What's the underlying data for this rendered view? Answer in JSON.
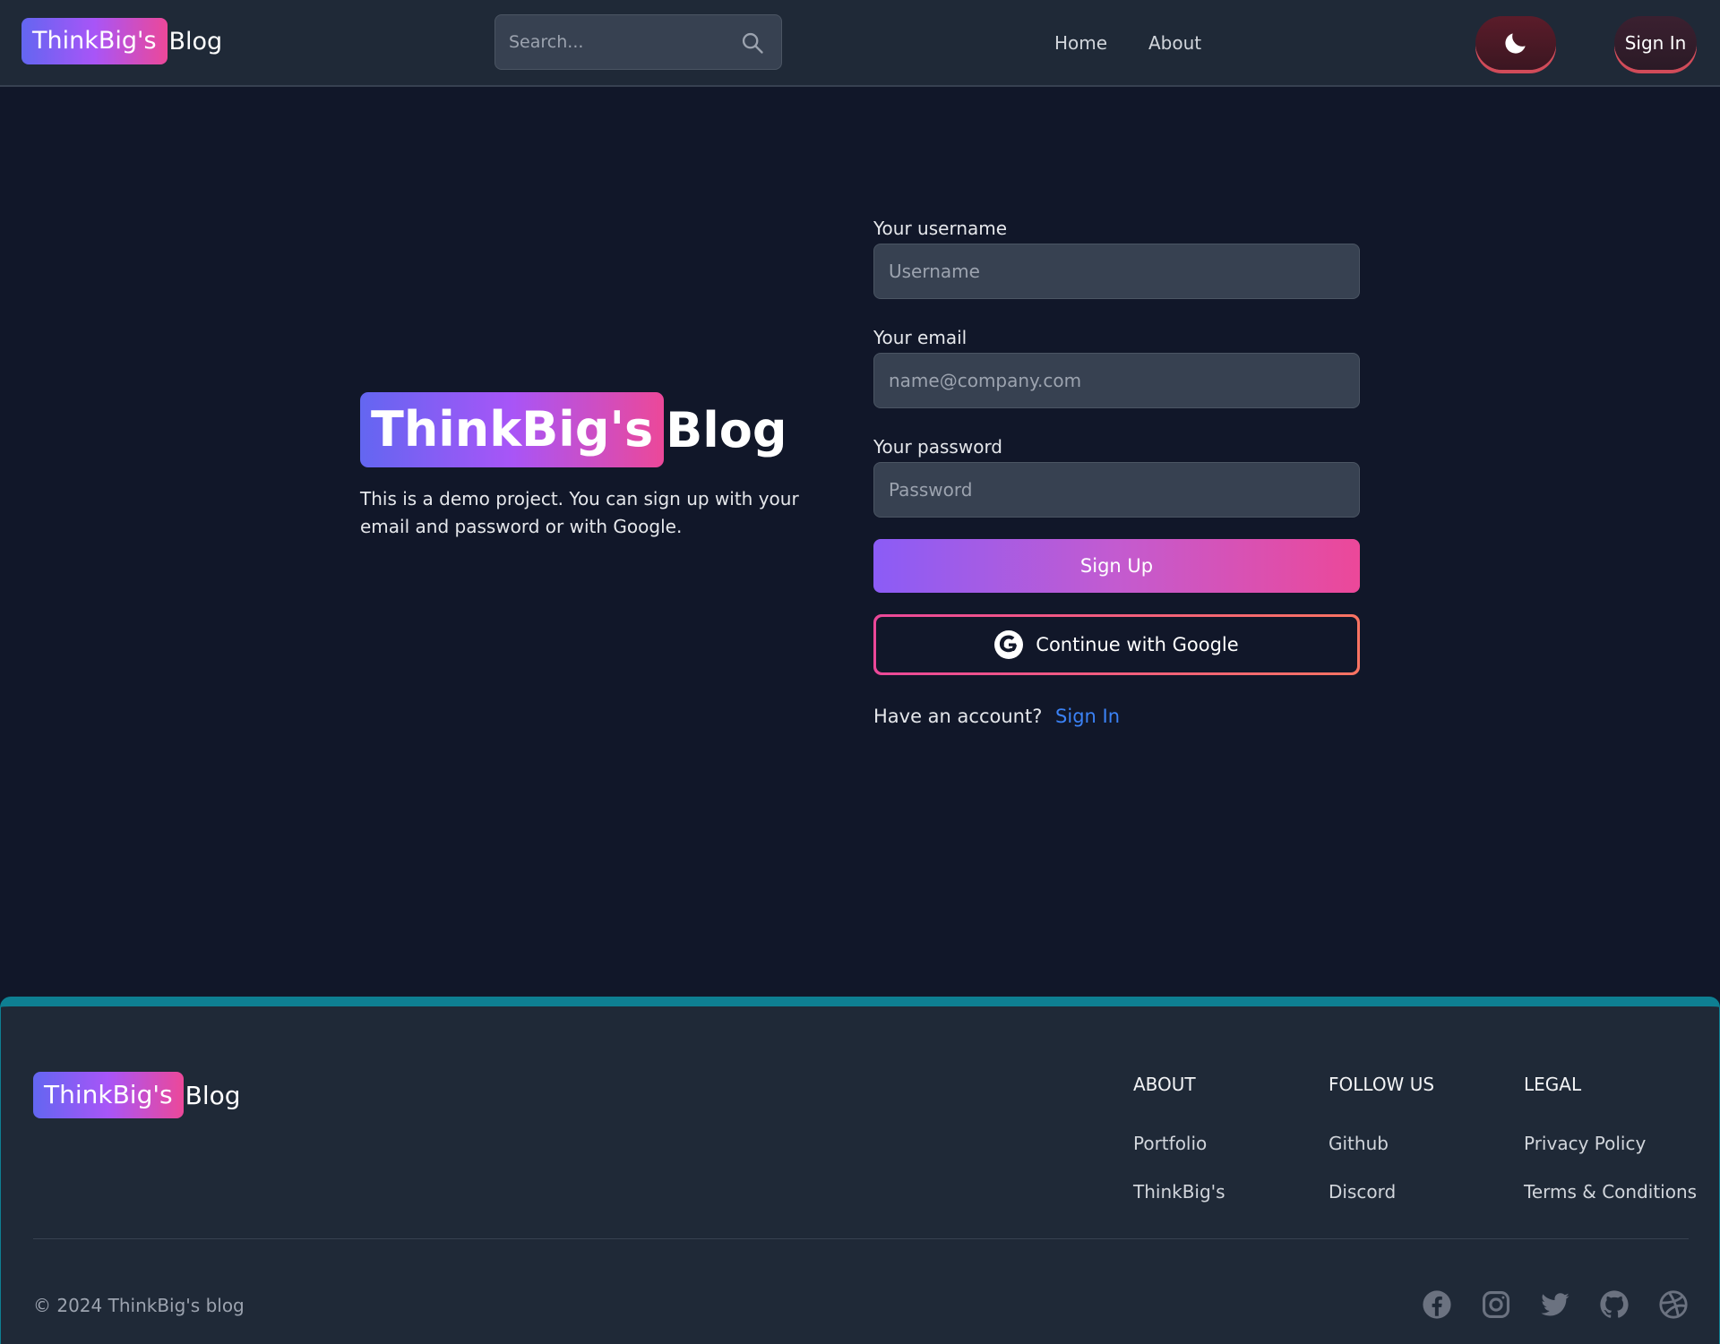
{
  "header": {
    "brand_badge": "ThinkBig's",
    "brand_rest": "Blog",
    "search_placeholder": "Search...",
    "nav": [
      {
        "label": "Home"
      },
      {
        "label": "About"
      }
    ],
    "theme_icon": "moon-icon",
    "signin_label": "Sign In"
  },
  "hero": {
    "brand_badge": "ThinkBig's",
    "brand_rest": "Blog",
    "description": "This is a demo project. You can sign up with your email and password or with Google."
  },
  "form": {
    "username_label": "Your username",
    "username_placeholder": "Username",
    "email_label": "Your email",
    "email_placeholder": "name@company.com",
    "password_label": "Your password",
    "password_placeholder": "Password",
    "signup_label": "Sign Up",
    "google_label": "Continue with Google",
    "have_account_text": "Have an account?",
    "signin_link": "Sign In"
  },
  "footer": {
    "brand_badge": "ThinkBig's",
    "brand_rest": "Blog",
    "columns": [
      {
        "title": "About",
        "links": [
          "Portfolio",
          "ThinkBig's"
        ]
      },
      {
        "title": "Follow us",
        "links": [
          "Github",
          "Discord"
        ]
      },
      {
        "title": "Legal",
        "links": [
          "Privacy Policy",
          "Terms & Conditions"
        ]
      }
    ],
    "copyright": "© 2024 ThinkBig's blog",
    "social_icons": [
      "facebook-icon",
      "instagram-icon",
      "twitter-icon",
      "github-icon",
      "dribbble-icon"
    ]
  },
  "colors": {
    "page_bg": "#111729",
    "header_bg": "#1f2937",
    "accent_gradient_start": "#6366f1",
    "accent_gradient_end": "#ec4899",
    "link_blue": "#3b82f6",
    "footer_top_border": "#0e7f92"
  }
}
